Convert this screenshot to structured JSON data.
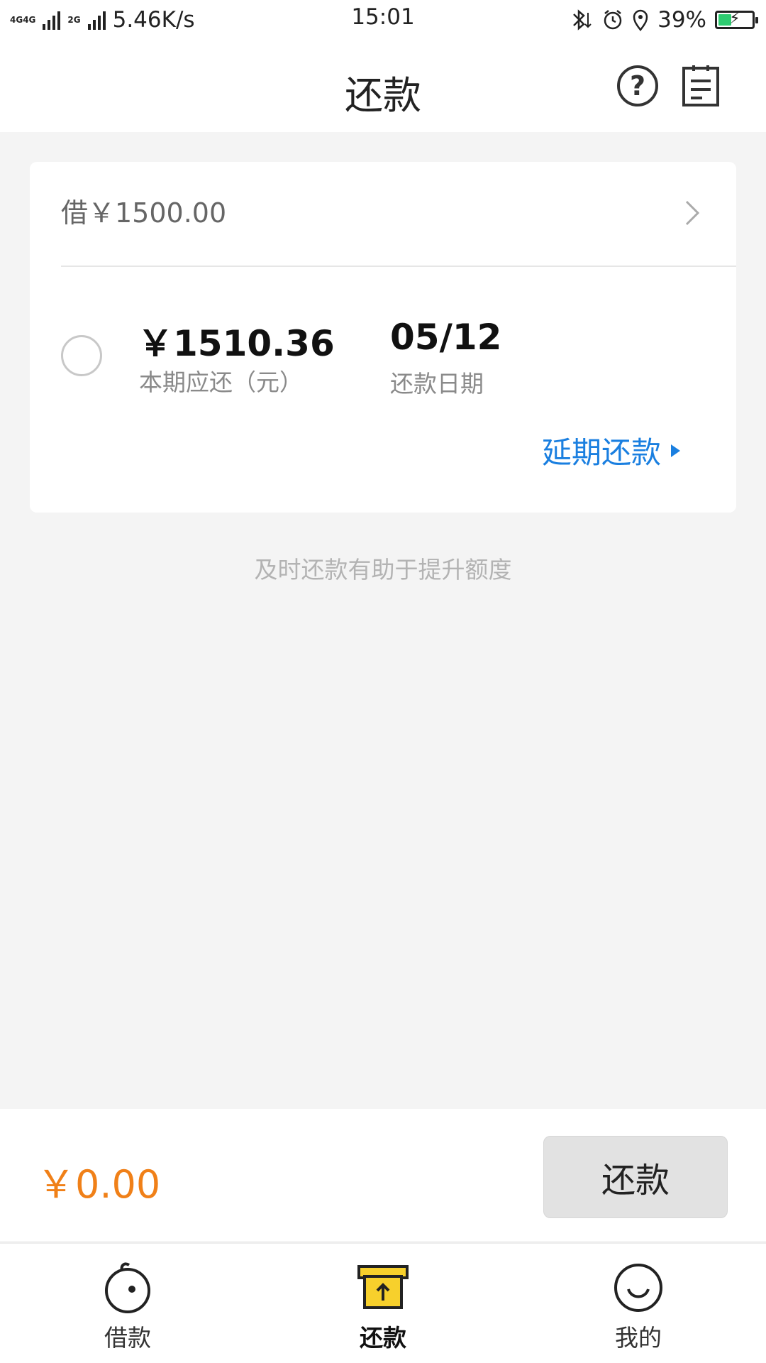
{
  "status_bar": {
    "network_1": "4G",
    "network_2": "4G",
    "network_3": "2G",
    "speed": "5.46K/s",
    "time": "15:01",
    "battery_percent": "39%",
    "battery_level": 0.39,
    "battery_color": "#2ecc71"
  },
  "header": {
    "title": "还款",
    "help_icon": "help-circle-icon",
    "record_icon": "bill-record-icon"
  },
  "loan_card": {
    "loan_label": "借￥1500.00",
    "amount": "￥1510.36",
    "amount_label": "本期应还（元）",
    "due_date": "05/12",
    "due_date_label": "还款日期",
    "extend_link": "延期还款"
  },
  "tip": "及时还款有助于提升额度",
  "pay_bar": {
    "total": "￥0.00",
    "total_color": "#f08018",
    "button_label": "还款"
  },
  "tabs": [
    {
      "label": "借款",
      "icon": "borrow-icon"
    },
    {
      "label": "还款",
      "icon": "repay-icon",
      "active": true,
      "icon_color": "#f7d02c"
    },
    {
      "label": "我的",
      "icon": "smile-icon"
    }
  ]
}
